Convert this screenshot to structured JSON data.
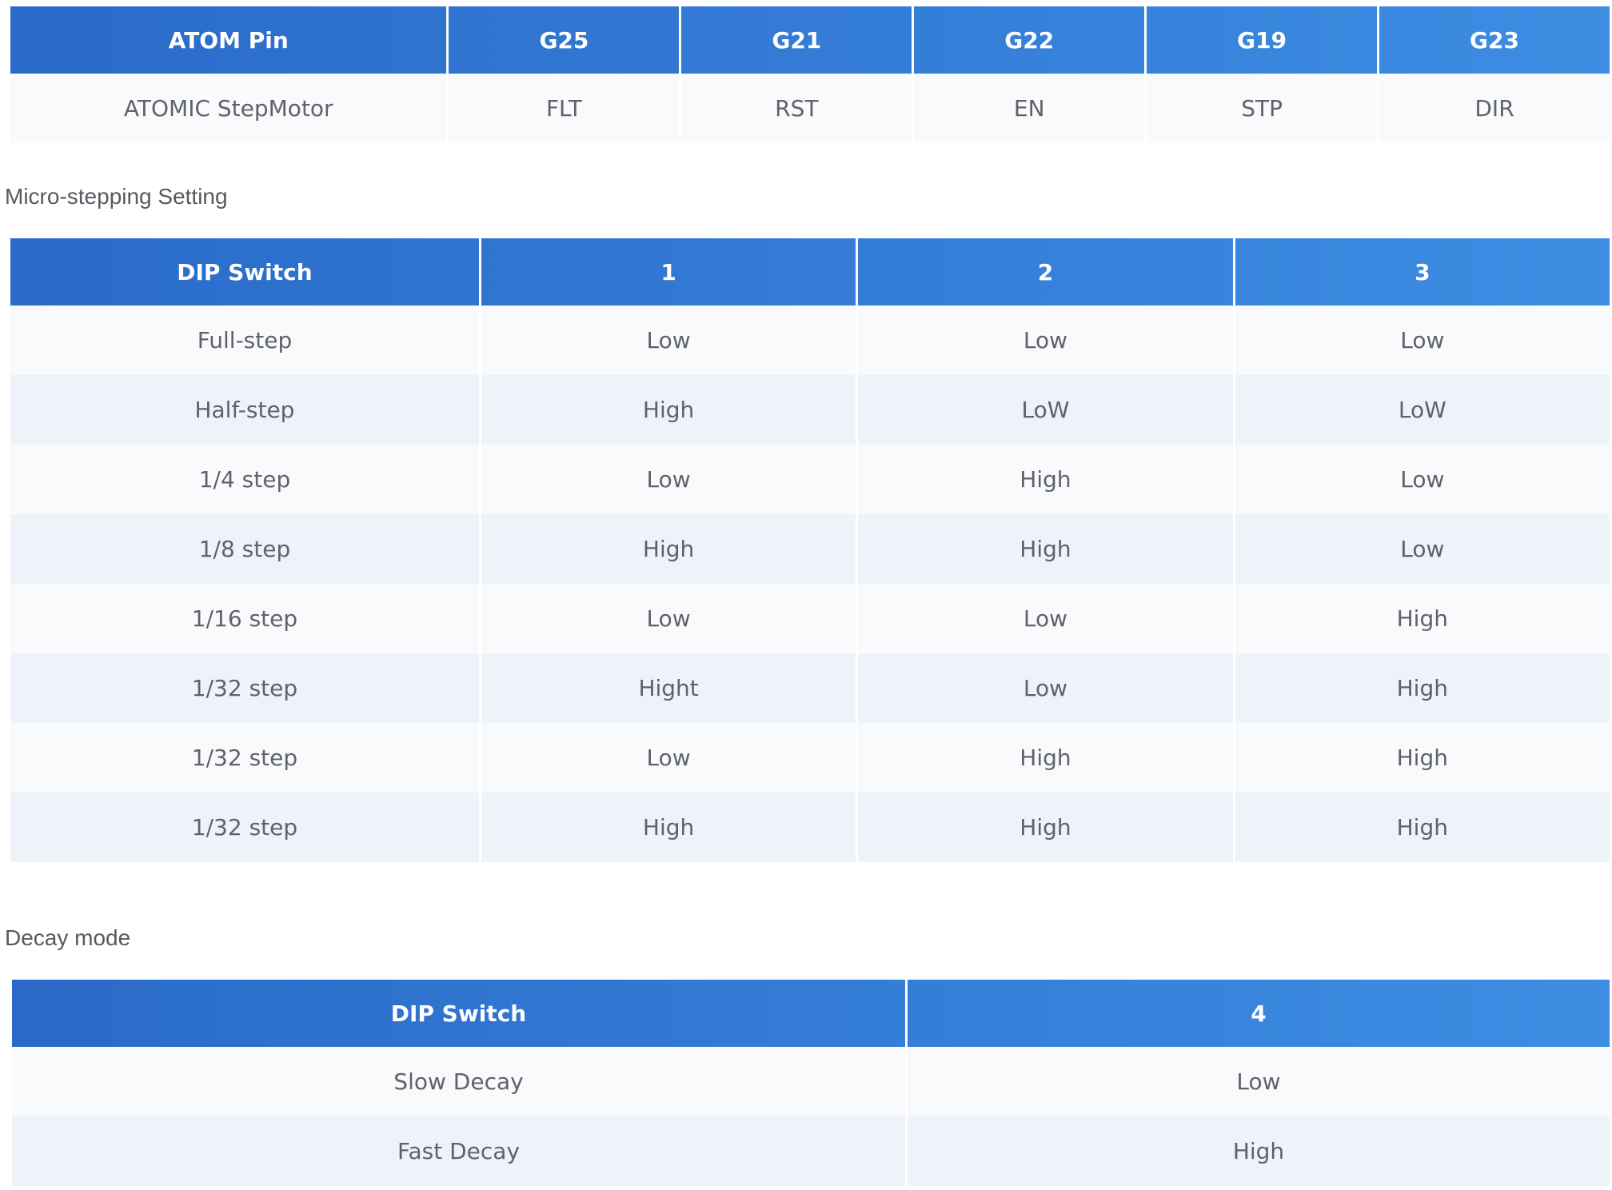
{
  "pin_table": {
    "headers": [
      "ATOM Pin",
      "G25",
      "G21",
      "G22",
      "G19",
      "G23"
    ],
    "row": [
      "ATOMIC StepMotor",
      "FLT",
      "RST",
      "EN",
      "STP",
      "DIR"
    ]
  },
  "micro_stepping": {
    "label": "Micro-stepping Setting",
    "headers": [
      "DIP Switch",
      "1",
      "2",
      "3"
    ],
    "rows": [
      [
        "Full-step",
        "Low",
        "Low",
        "Low"
      ],
      [
        "Half-step",
        "High",
        "LoW",
        "LoW"
      ],
      [
        "1/4 step",
        "Low",
        "High",
        "Low"
      ],
      [
        "1/8 step",
        "High",
        "High",
        "Low"
      ],
      [
        "1/16 step",
        "Low",
        "Low",
        "High"
      ],
      [
        "1/32 step",
        "Hight",
        "Low",
        "High"
      ],
      [
        "1/32 step",
        "Low",
        "High",
        "High"
      ],
      [
        "1/32 step",
        "High",
        "High",
        "High"
      ]
    ]
  },
  "decay_mode": {
    "label": "Decay mode",
    "headers": [
      "DIP Switch",
      "4"
    ],
    "rows": [
      [
        "Slow Decay",
        "Low"
      ],
      [
        "Fast Decay",
        "High"
      ]
    ]
  },
  "colors": {
    "header_gradient_start": "#2a6ac8",
    "header_gradient_end": "#3d8de3",
    "header_text": "#ffffff",
    "cell_text": "#5f6369",
    "row_light": "#f9fafc",
    "row_alt": "#eef3fa"
  }
}
